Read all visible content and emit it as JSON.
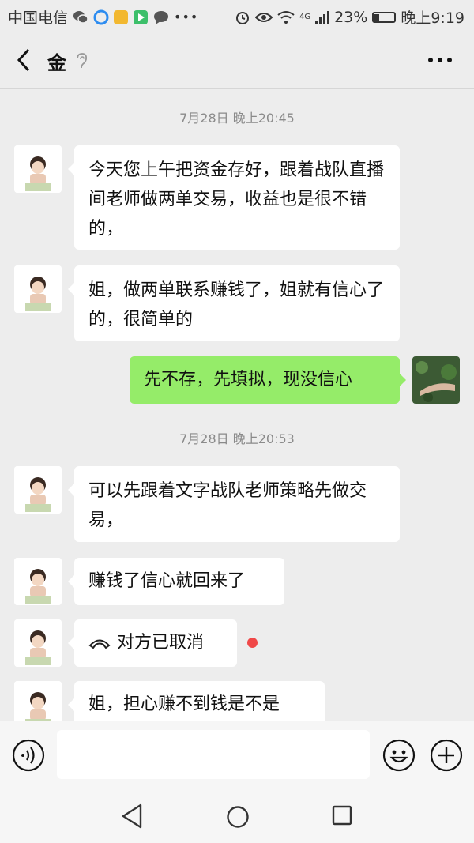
{
  "status": {
    "carrier": "中国电信",
    "network": "4G",
    "battery": "23%",
    "battery_level": 0.23,
    "time": "晚上9:19"
  },
  "header": {
    "title": "金"
  },
  "messages": [
    {
      "type": "time",
      "text": "7月28日 晚上20:45"
    },
    {
      "type": "left",
      "text": "今天您上午把资金存好，跟着战队直播间老师做两单交易，收益也是很不错的，"
    },
    {
      "type": "left",
      "text": "姐，做两单联系赚钱了，姐就有信心了的，很简单的"
    },
    {
      "type": "right",
      "text": "先不存，先填拟，现没信心"
    },
    {
      "type": "time",
      "text": "7月28日 晚上20:53"
    },
    {
      "type": "left",
      "text": "可以先跟着文字战队老师策略先做交易，"
    },
    {
      "type": "left",
      "text": "赚钱了信心就回来了"
    },
    {
      "type": "call",
      "text": "对方已取消"
    },
    {
      "type": "left",
      "text": "姐，担心赚不到钱是不是"
    }
  ],
  "colors": {
    "background": "#ededed",
    "my_bubble": "#95ec69",
    "other_bubble": "#ffffff",
    "unread_dot": "#f04848"
  }
}
